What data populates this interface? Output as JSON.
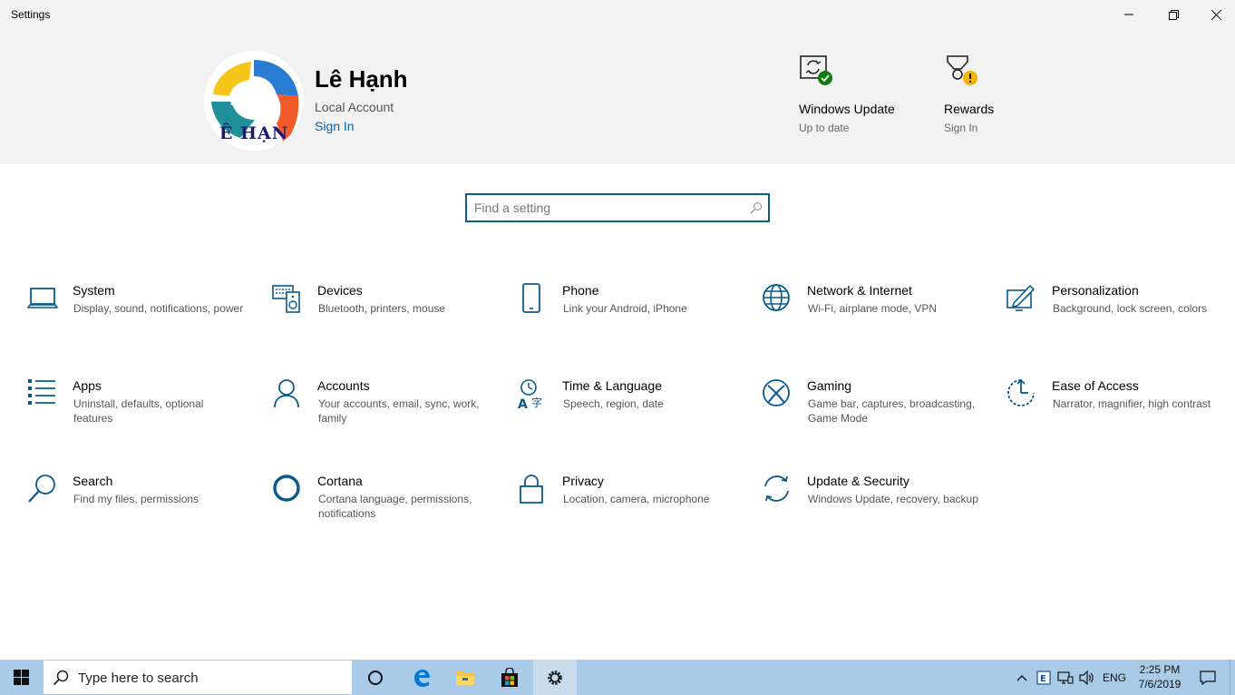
{
  "window": {
    "title": "Settings",
    "controls": [
      "minimize",
      "restore",
      "close"
    ]
  },
  "header": {
    "avatar_text": "Ê HẠN",
    "user_name": "Lê Hạnh",
    "account_type": "Local Account",
    "sign_in": "Sign In",
    "tiles": [
      {
        "title": "Windows Update",
        "subtitle": "Up to date",
        "icon": "windows-update-icon"
      },
      {
        "title": "Rewards",
        "subtitle": "Sign In",
        "icon": "rewards-icon"
      }
    ]
  },
  "search": {
    "placeholder": "Find a setting"
  },
  "categories": [
    {
      "title": "System",
      "desc": "Display, sound, notifications, power",
      "icon": "laptop-icon"
    },
    {
      "title": "Devices",
      "desc": "Bluetooth, printers, mouse",
      "icon": "devices-icon"
    },
    {
      "title": "Phone",
      "desc": "Link your Android, iPhone",
      "icon": "phone-icon"
    },
    {
      "title": "Network & Internet",
      "desc": "Wi-Fi, airplane mode, VPN",
      "icon": "globe-icon"
    },
    {
      "title": "Personalization",
      "desc": "Background, lock screen, colors",
      "icon": "personalization-icon"
    },
    {
      "title": "Apps",
      "desc": "Uninstall, defaults, optional features",
      "icon": "apps-list-icon"
    },
    {
      "title": "Accounts",
      "desc": "Your accounts, email, sync, work, family",
      "icon": "person-icon"
    },
    {
      "title": "Time & Language",
      "desc": "Speech, region, date",
      "icon": "time-language-icon"
    },
    {
      "title": "Gaming",
      "desc": "Game bar, captures, broadcasting, Game Mode",
      "icon": "xbox-icon"
    },
    {
      "title": "Ease of Access",
      "desc": "Narrator, magnifier, high contrast",
      "icon": "ease-of-access-icon"
    },
    {
      "title": "Search",
      "desc": "Find my files, permissions",
      "icon": "search-icon"
    },
    {
      "title": "Cortana",
      "desc": "Cortana language, permissions, notifications",
      "icon": "cortana-icon"
    },
    {
      "title": "Privacy",
      "desc": "Location, camera, microphone",
      "icon": "lock-icon"
    },
    {
      "title": "Update & Security",
      "desc": "Windows Update, recovery, backup",
      "icon": "sync-icon"
    }
  ],
  "taskbar": {
    "search_placeholder": "Type here to search",
    "apps": [
      "cortana",
      "edge",
      "file-explorer",
      "store",
      "settings"
    ],
    "language": "ENG",
    "time": "2:25 PM",
    "date": "7/6/2019"
  },
  "colors": {
    "accent": "#0063b1",
    "icon_blue": "#0a5a8c",
    "header_bg": "#f2f2f2",
    "taskbar_bg": "#a9cbe8"
  }
}
